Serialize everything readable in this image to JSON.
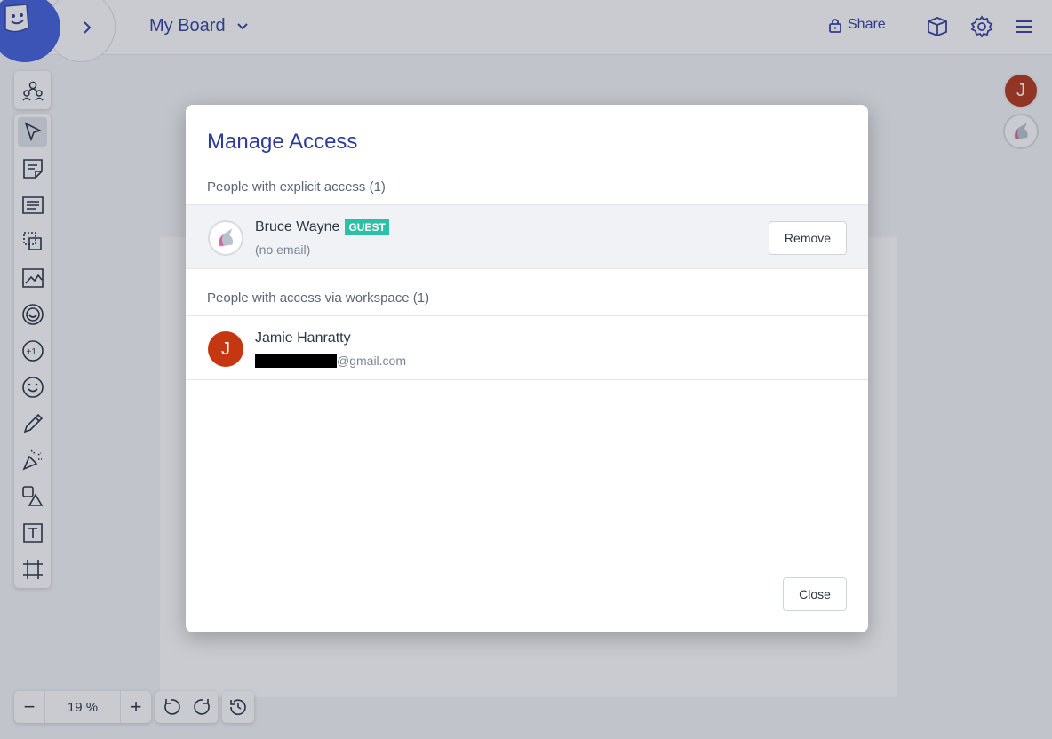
{
  "header": {
    "board_title": "My Board",
    "share_label": "Share"
  },
  "zoom": {
    "value": "19 %",
    "minus": "−",
    "plus": "+"
  },
  "avatars": {
    "current_user_initial": "J"
  },
  "modal": {
    "title": "Manage Access",
    "explicit_section": "People with explicit access (1)",
    "workspace_section": "People with access via workspace (1)",
    "explicit_users": [
      {
        "name": "Bruce Wayne",
        "badge": "GUEST",
        "email": "(no email)",
        "action": "Remove"
      }
    ],
    "workspace_users": [
      {
        "initial": "J",
        "name": "Jamie Hanratty",
        "email_suffix": "@gmail.com"
      }
    ],
    "close_label": "Close"
  }
}
